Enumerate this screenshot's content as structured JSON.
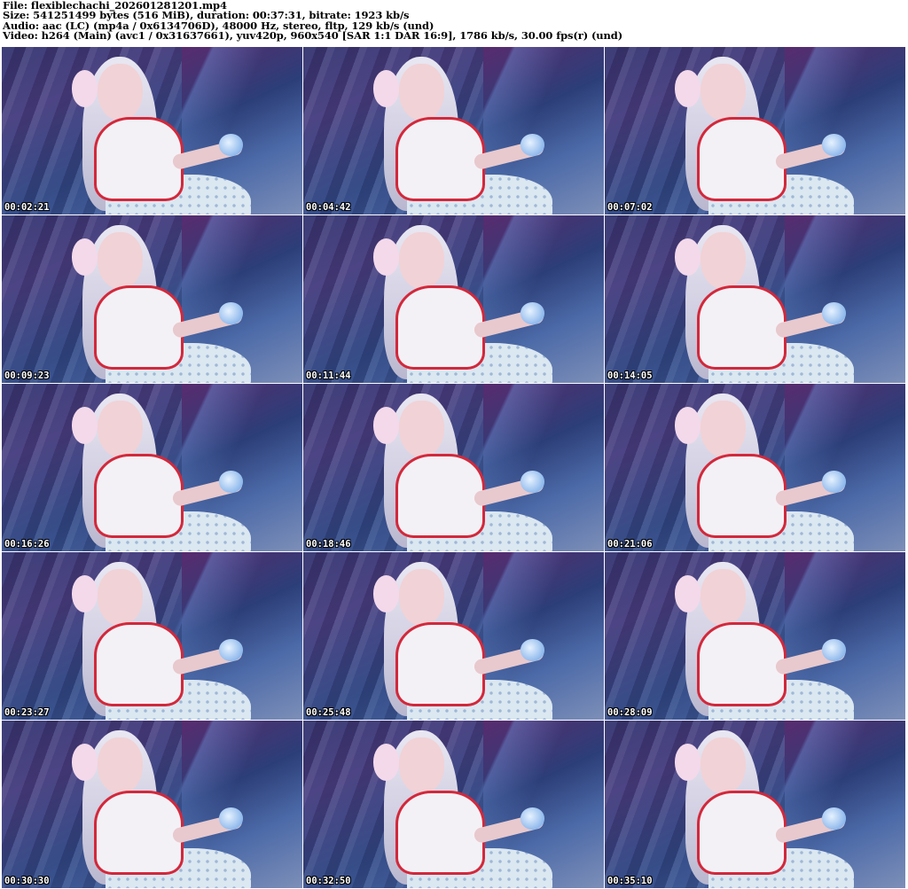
{
  "header": {
    "file_line": "File: flexiblechachi_202601281201.mp4",
    "size_line": "Size: 541251499 bytes (516 MiB), duration: 00:37:31, bitrate: 1923 kb/s",
    "audio_line": "Audio: aac (LC) (mp4a / 0x6134706D), 48000 Hz, stereo, fltp, 129 kb/s (und)",
    "video_line": "Video: h264 (Main) (avc1 / 0x31637661), yuv420p, 960x540 [SAR 1:1 DAR 16:9], 1786 kb/s, 30.00 fps(r) (und)"
  },
  "thumbnails": [
    {
      "timestamp": "00:02:21"
    },
    {
      "timestamp": "00:04:42"
    },
    {
      "timestamp": "00:07:02"
    },
    {
      "timestamp": "00:09:23"
    },
    {
      "timestamp": "00:11:44"
    },
    {
      "timestamp": "00:14:05"
    },
    {
      "timestamp": "00:16:26"
    },
    {
      "timestamp": "00:18:46"
    },
    {
      "timestamp": "00:21:06"
    },
    {
      "timestamp": "00:23:27"
    },
    {
      "timestamp": "00:25:48"
    },
    {
      "timestamp": "00:28:09"
    },
    {
      "timestamp": "00:30:30"
    },
    {
      "timestamp": "00:32:50"
    },
    {
      "timestamp": "00:35:10"
    }
  ]
}
